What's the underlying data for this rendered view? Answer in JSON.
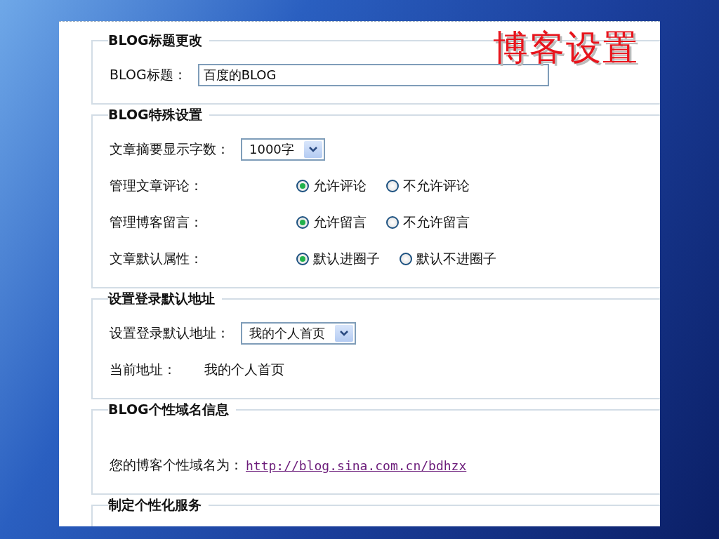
{
  "slide_title": "博客设置",
  "sections": [
    {
      "legend": "BLOG标题更改",
      "rows": [
        {
          "kind": "text",
          "label": "BLOG标题：",
          "value": "百度的BLOG"
        }
      ]
    },
    {
      "legend": "BLOG特殊设置",
      "rows": [
        {
          "kind": "select",
          "label": "文章摘要显示字数：",
          "value": "1000字"
        },
        {
          "kind": "radio",
          "label": "管理文章评论：",
          "options": [
            {
              "label": "允许评论",
              "selected": true
            },
            {
              "label": "不允许评论",
              "selected": false
            }
          ]
        },
        {
          "kind": "radio",
          "label": "管理博客留言：",
          "options": [
            {
              "label": "允许留言",
              "selected": true
            },
            {
              "label": "不允许留言",
              "selected": false
            }
          ]
        },
        {
          "kind": "radio",
          "label": "文章默认属性：",
          "options": [
            {
              "label": "默认进圈子",
              "selected": true
            },
            {
              "label": "默认不进圈子",
              "selected": false
            }
          ]
        }
      ]
    },
    {
      "legend": "设置登录默认地址",
      "rows": [
        {
          "kind": "select",
          "label": "设置登录默认地址：",
          "value": "我的个人首页"
        },
        {
          "kind": "info",
          "label": "当前地址：",
          "value": "我的个人首页"
        }
      ]
    },
    {
      "legend": "BLOG个性域名信息",
      "rows": [
        {
          "kind": "link",
          "label": "您的博客个性域名为：",
          "value": "http://blog.sina.com.cn/bdhzx"
        }
      ]
    },
    {
      "legend": "制定个性化服务"
    }
  ]
}
